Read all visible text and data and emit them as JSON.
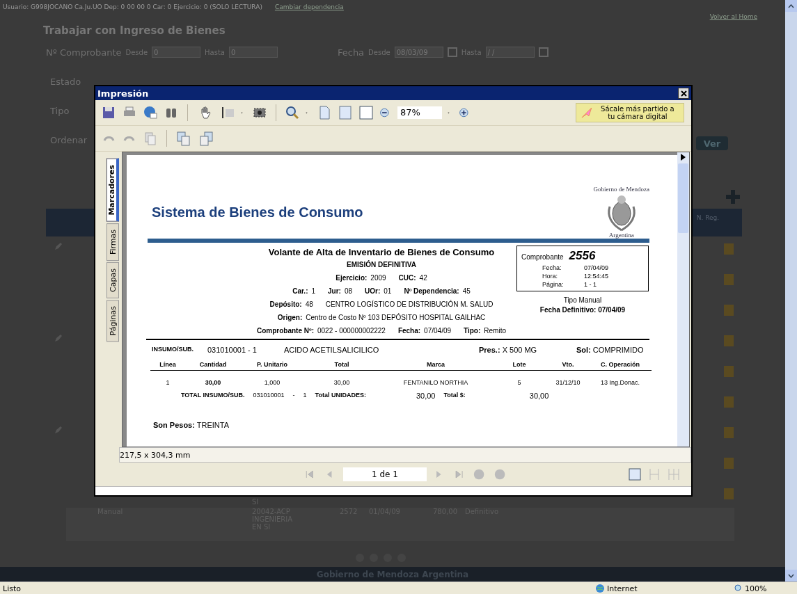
{
  "background_page": {
    "user_bar": "Usuario: G998JOCANO Ca.Ju.UO Dep: 0 00 00 0 Car: 0 Ejercicio: 0 (SOLO LECTURA)",
    "user_link": "Cambiar dependencia",
    "home_link": "Volver al Home",
    "title": "Trabajar con Ingreso de Bienes",
    "filter": {
      "label": "Nº Comprobante",
      "from_label": "Desde",
      "from": "0",
      "to_label": "Hasta",
      "to": "0",
      "date_label": "Fecha",
      "date_from_label": "Desde",
      "date_from": "08/03/09",
      "date_to_label": "Hasta",
      "date_to": "/ /"
    },
    "filter_labels": [
      "Estado",
      "Tipo",
      "Ordenar"
    ],
    "view_button": "Ver",
    "column_header": "N. Reg.",
    "prev_row_fragment": "SI",
    "row": [
      "Manual",
      "20042-ACP INGENIERIA EN SI",
      "2572",
      "01/04/09",
      "780,00",
      "Definitivo"
    ],
    "footer": "Gobierno de Mendoza Argentina"
  },
  "dialog": {
    "title": "Impresión",
    "zoom": "87%",
    "promo": "Sácale más partido a tu cámara digital",
    "side_tabs": [
      {
        "label": "Marcadores",
        "selected": true
      },
      {
        "label": "Firmas",
        "selected": false
      },
      {
        "label": "Capas",
        "selected": false
      },
      {
        "label": "Páginas",
        "selected": false
      }
    ],
    "document": {
      "system_title": "Sistema de Bienes de Consumo",
      "logo_top": "Gobierno de Mendoza",
      "logo_bottom": "Argentina",
      "heading": "Volante de Alta de Inventario de Bienes de Consumo",
      "subheading": "EMISIÓN DEFINITIVA",
      "info_lines": [
        [
          {
            "label": "Ejercicio:",
            "value": "2009"
          },
          {
            "label": "CUC:",
            "value": "42"
          }
        ],
        [
          {
            "label": "Car.:",
            "value": "1"
          },
          {
            "label": "Jur:",
            "value": "08"
          },
          {
            "label": "UOr:",
            "value": "01"
          },
          {
            "label": "Nº Dependencia:",
            "value": "45"
          }
        ],
        [
          {
            "label": "Depósito:",
            "value": "48"
          },
          {
            "value": "CENTRO LOGÍSTICO DE DISTRIBUCIÓN M. SALUD"
          }
        ],
        [
          {
            "label": "Origen:",
            "value": "Centro de Costo Nº 103 DEPÓSITO HOSPITAL GAILHAC"
          }
        ],
        [
          {
            "label": "Comprobante Nº:",
            "value": "0022 - 000000002222"
          },
          {
            "label": "Fecha:",
            "value": "07/04/09"
          },
          {
            "label": "Tipo:",
            "value": "Remito"
          }
        ]
      ],
      "voucher": {
        "label": "Comprobante",
        "number": "2556",
        "fields": [
          {
            "label": "Fecha:",
            "value": "07/04/09"
          },
          {
            "label": "Hora:",
            "value": "12:54:45"
          },
          {
            "label": "Página:",
            "value": "1 - 1"
          }
        ]
      },
      "type_line": "Tipo Manual",
      "final_date": "Fecha Definitivo: 07/04/09",
      "item": {
        "label": "INSUMO/SUB.",
        "code": "031010001 - 1",
        "name": "ACIDO ACETILSALICILICO",
        "pres_label": "Pres.:",
        "pres": "X 500 MG",
        "sol_label": "Sol:",
        "sol": "COMPRIMIDO"
      },
      "columns": [
        "Línea",
        "Cantidad",
        "P. Unitario",
        "Total",
        "Marca",
        "Lote",
        "Vto.",
        "C. Operación"
      ],
      "rows": [
        [
          "1",
          "30,00",
          "1,000",
          "30,00",
          "FENTANILO NORTHIA",
          "5",
          "31/12/10",
          "13 Ing.Donac."
        ]
      ],
      "totals": [
        "TOTAL INSUMO/SUB.",
        "031010001",
        "-",
        "1",
        "Total UNIDADES:",
        "30,00",
        "Total $:",
        "30,00"
      ],
      "amount_label": "Son Pesos:",
      "amount": "TREINTA"
    },
    "page_size": "217,5 x 304,3 mm",
    "page_indicator": "1 de 1"
  },
  "status_bar": {
    "text": "Listo",
    "zone": "Internet",
    "zoom": "100%"
  }
}
